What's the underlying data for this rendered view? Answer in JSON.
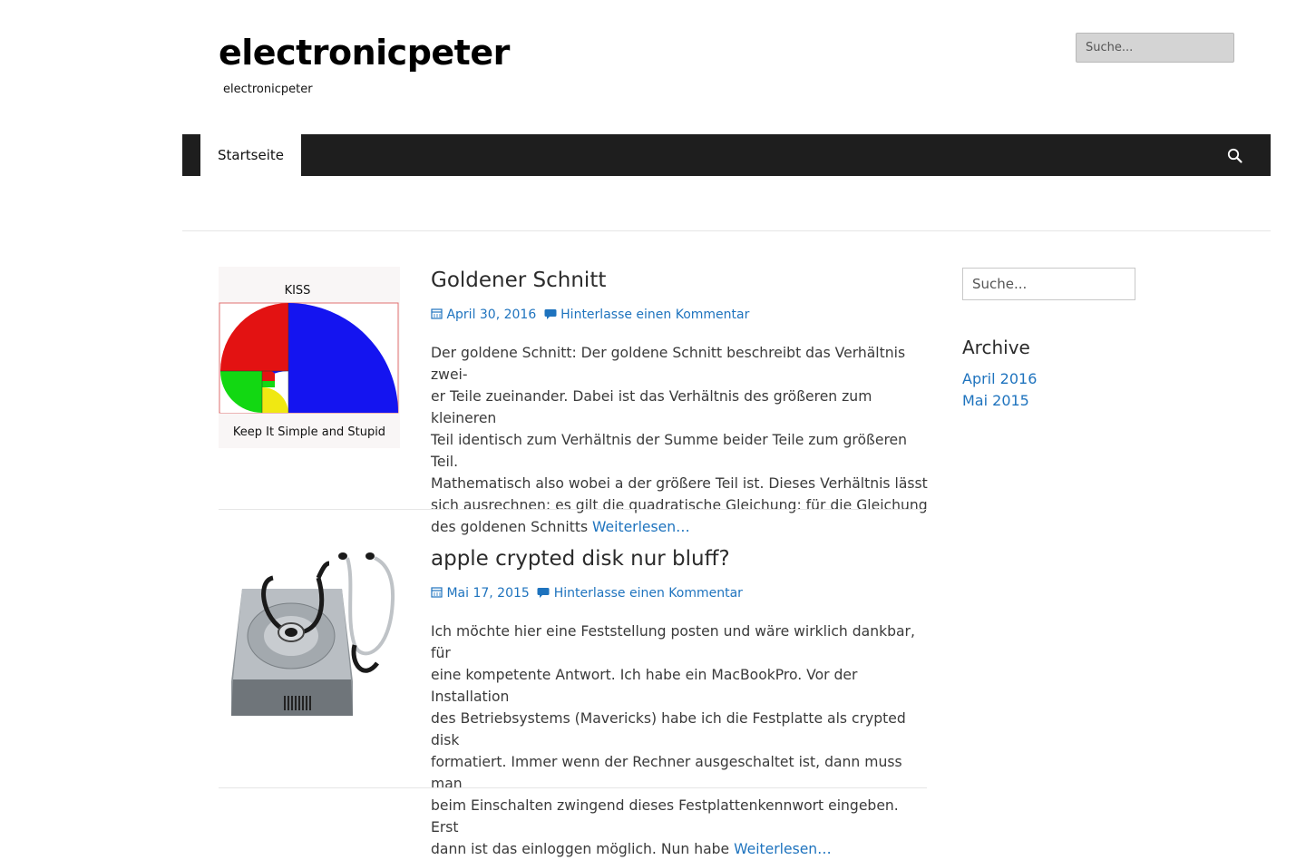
{
  "header": {
    "site_title": "electronicpeter",
    "tagline": "electronicpeter",
    "search_placeholder": "Suche..."
  },
  "nav": {
    "items": [
      {
        "label": "Startseite"
      }
    ],
    "search_icon": "search-icon"
  },
  "posts": [
    {
      "title": "Goldener Schnitt",
      "date": "April 30, 2016",
      "comment_link": "Hinterlasse einen Kommentar",
      "excerpt_lines": [
        "Der goldene Schnitt: Der goldene Schnitt beschreibt das Verhältnis zwei-",
        "er Teile zueinander. Dabei ist das Verhältnis des größeren zum kleineren",
        "Teil identisch zum Verhältnis der Summe beider Teile zum größeren Teil.",
        "Mathematisch also wobei a der größere Teil ist. Dieses Verhältnis lässt",
        "sich ausrechnen: es gilt die quadratische Gleichung: für die Gleichung",
        "des goldenen Schnitts"
      ],
      "more": "Weiterlesen…",
      "thumb_top_text": "KISS",
      "thumb_bottom_text": "Keep It Simple and Stupid",
      "colors": {
        "red": "#e31212",
        "blue": "#1414f0",
        "green": "#12d812",
        "yellow": "#f0e812"
      }
    },
    {
      "title": "apple crypted disk nur bluff?",
      "date": "Mai 17, 2015",
      "comment_link": "Hinterlasse einen Kommentar",
      "excerpt_lines": [
        "Ich möchte hier eine Feststellung posten und wäre wirklich dankbar, für",
        "eine kompetente Antwort. Ich habe ein MacBookPro. Vor der Installation",
        "des Betriebsystems (Mavericks) habe ich die Festplatte als crypted disk",
        "formatiert. Immer wenn der Rechner ausgeschaltet ist, dann muss man",
        "beim Einschalten zwingend dieses Festplattenkennwort eingeben. Erst",
        "dann ist das einloggen möglich. Nun habe"
      ],
      "more": "Weiterlesen…",
      "thumb_icon": "disk-utility-icon"
    }
  ],
  "sidebar": {
    "search_placeholder": "Suche...",
    "archive_title": "Archive",
    "archive_links": [
      "April 2016",
      "Mai 2015"
    ]
  },
  "colors": {
    "link": "#1e73be",
    "nav_bg": "#1e1e1e"
  }
}
